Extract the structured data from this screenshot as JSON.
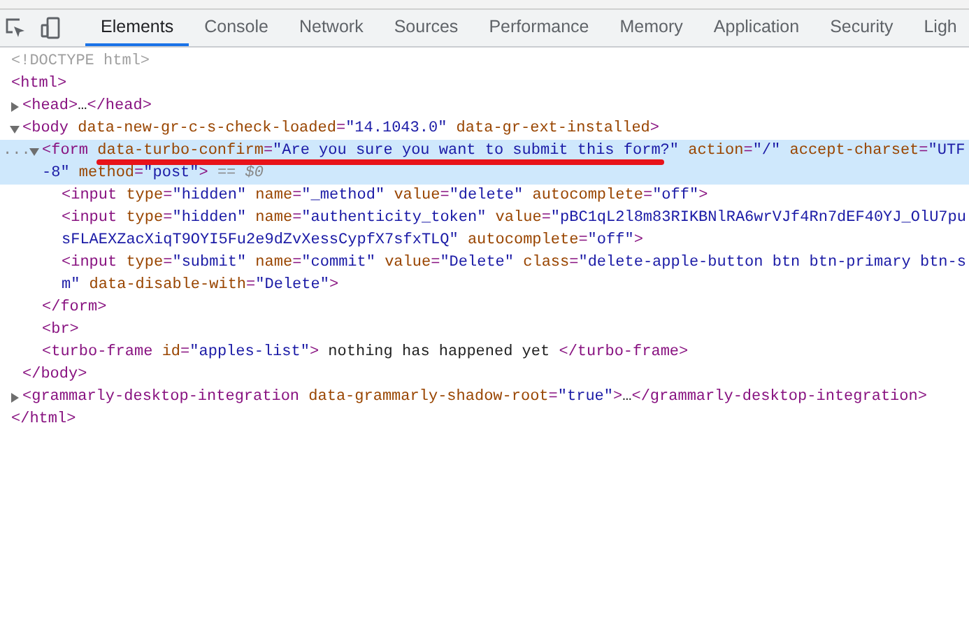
{
  "toolbar": {
    "tabs": [
      {
        "label": "Elements",
        "selected": true
      },
      {
        "label": "Console",
        "selected": false
      },
      {
        "label": "Network",
        "selected": false
      },
      {
        "label": "Sources",
        "selected": false
      },
      {
        "label": "Performance",
        "selected": false
      },
      {
        "label": "Memory",
        "selected": false
      },
      {
        "label": "Application",
        "selected": false
      },
      {
        "label": "Security",
        "selected": false
      },
      {
        "label": "Ligh",
        "selected": false
      }
    ]
  },
  "dom_tree": [
    {
      "selected": false,
      "open": [
        [
          {
            "kind": "doctype",
            "text": "<!DOCTYPE html>"
          }
        ]
      ]
    },
    {
      "selected": false,
      "open": [
        [
          {
            "kind": "tag",
            "text": "<html>"
          }
        ]
      ],
      "close": [
        {
          "kind": "tag",
          "text": "</html>"
        }
      ],
      "children": [
        {
          "selected": false,
          "expanded": false,
          "open": [
            [
              {
                "kind": "tag",
                "text": "<head>"
              },
              {
                "kind": "text",
                "text": "…"
              },
              {
                "kind": "tag",
                "text": "</head>"
              }
            ]
          ]
        },
        {
          "selected": false,
          "expanded": true,
          "open": [
            [
              {
                "kind": "tag",
                "text": "<body"
              },
              {
                "kind": "attr",
                "text": " data-new-gr-c-s-check-loaded"
              },
              {
                "kind": "punct",
                "text": "="
              },
              {
                "kind": "value",
                "text": "\"14.1043.0\""
              },
              {
                "kind": "attr",
                "text": " data-gr-ext-installed"
              },
              {
                "kind": "tag",
                "text": ">"
              }
            ]
          ],
          "close": [
            {
              "kind": "tag",
              "text": "</body>"
            }
          ],
          "children": [
            {
              "selected": true,
              "expanded": true,
              "gutter": "...",
              "open": [
                [
                  {
                    "kind": "tag",
                    "text": "<form"
                  },
                  {
                    "kind": "attr",
                    "text": " data-turbo-confirm"
                  },
                  {
                    "kind": "punct",
                    "text": "="
                  },
                  {
                    "kind": "value",
                    "text": "\"Are you sure you want to submit this form?\""
                  },
                  {
                    "kind": "attr",
                    "text": " action"
                  },
                  {
                    "kind": "punct",
                    "text": "="
                  },
                  {
                    "kind": "value",
                    "text": "\"/\""
                  },
                  {
                    "kind": "attr",
                    "text": " accept-charset"
                  },
                  {
                    "kind": "punct",
                    "text": "="
                  },
                  {
                    "kind": "value",
                    "text": "\"UTF"
                  }
                ],
                [
                  {
                    "kind": "value",
                    "text": "-8\""
                  },
                  {
                    "kind": "attr",
                    "text": " method"
                  },
                  {
                    "kind": "punct",
                    "text": "="
                  },
                  {
                    "kind": "value",
                    "text": "\"post\""
                  },
                  {
                    "kind": "tag",
                    "text": ">"
                  },
                  {
                    "kind": "hint",
                    "text": " == $0"
                  }
                ]
              ],
              "close": [
                {
                  "kind": "tag",
                  "text": "</form>"
                }
              ],
              "children": [
                {
                  "selected": false,
                  "open": [
                    [
                      {
                        "kind": "tag",
                        "text": "<input"
                      },
                      {
                        "kind": "attr",
                        "text": " type"
                      },
                      {
                        "kind": "punct",
                        "text": "="
                      },
                      {
                        "kind": "value",
                        "text": "\"hidden\""
                      },
                      {
                        "kind": "attr",
                        "text": " name"
                      },
                      {
                        "kind": "punct",
                        "text": "="
                      },
                      {
                        "kind": "value",
                        "text": "\"_method\""
                      },
                      {
                        "kind": "attr",
                        "text": " value"
                      },
                      {
                        "kind": "punct",
                        "text": "="
                      },
                      {
                        "kind": "value",
                        "text": "\"delete\""
                      },
                      {
                        "kind": "attr",
                        "text": " autocomplete"
                      },
                      {
                        "kind": "punct",
                        "text": "="
                      },
                      {
                        "kind": "value",
                        "text": "\"off\""
                      },
                      {
                        "kind": "tag",
                        "text": ">"
                      }
                    ]
                  ]
                },
                {
                  "selected": false,
                  "open": [
                    [
                      {
                        "kind": "tag",
                        "text": "<input"
                      },
                      {
                        "kind": "attr",
                        "text": " type"
                      },
                      {
                        "kind": "punct",
                        "text": "="
                      },
                      {
                        "kind": "value",
                        "text": "\"hidden\""
                      },
                      {
                        "kind": "attr",
                        "text": " name"
                      },
                      {
                        "kind": "punct",
                        "text": "="
                      },
                      {
                        "kind": "value",
                        "text": "\"authenticity_token\""
                      },
                      {
                        "kind": "attr",
                        "text": " value"
                      },
                      {
                        "kind": "punct",
                        "text": "="
                      },
                      {
                        "kind": "value",
                        "text": "\"pBC1qL2l8m83RIKBNlRA6wrVJf4Rn7dEF40YJ_OlU7pu"
                      }
                    ],
                    [
                      {
                        "kind": "value",
                        "text": "sFLAEXZacXiqT9OYI5Fu2e9dZvXessCypfX7sfxTLQ\""
                      },
                      {
                        "kind": "attr",
                        "text": " autocomplete"
                      },
                      {
                        "kind": "punct",
                        "text": "="
                      },
                      {
                        "kind": "value",
                        "text": "\"off\""
                      },
                      {
                        "kind": "tag",
                        "text": ">"
                      }
                    ]
                  ]
                },
                {
                  "selected": false,
                  "open": [
                    [
                      {
                        "kind": "tag",
                        "text": "<input"
                      },
                      {
                        "kind": "attr",
                        "text": " type"
                      },
                      {
                        "kind": "punct",
                        "text": "="
                      },
                      {
                        "kind": "value",
                        "text": "\"submit\""
                      },
                      {
                        "kind": "attr",
                        "text": " name"
                      },
                      {
                        "kind": "punct",
                        "text": "="
                      },
                      {
                        "kind": "value",
                        "text": "\"commit\""
                      },
                      {
                        "kind": "attr",
                        "text": " value"
                      },
                      {
                        "kind": "punct",
                        "text": "="
                      },
                      {
                        "kind": "value",
                        "text": "\"Delete\""
                      },
                      {
                        "kind": "attr",
                        "text": " class"
                      },
                      {
                        "kind": "punct",
                        "text": "="
                      },
                      {
                        "kind": "value",
                        "text": "\"delete-apple-button btn btn-primary btn-s"
                      }
                    ],
                    [
                      {
                        "kind": "value",
                        "text": "m\""
                      },
                      {
                        "kind": "attr",
                        "text": " data-disable-with"
                      },
                      {
                        "kind": "punct",
                        "text": "="
                      },
                      {
                        "kind": "value",
                        "text": "\"Delete\""
                      },
                      {
                        "kind": "tag",
                        "text": ">"
                      }
                    ]
                  ]
                }
              ]
            },
            {
              "selected": false,
              "open": [
                [
                  {
                    "kind": "tag",
                    "text": "<br>"
                  }
                ]
              ]
            },
            {
              "selected": false,
              "open": [
                [
                  {
                    "kind": "tag",
                    "text": "<turbo-frame"
                  },
                  {
                    "kind": "attr",
                    "text": " id"
                  },
                  {
                    "kind": "punct",
                    "text": "="
                  },
                  {
                    "kind": "value",
                    "text": "\"apples-list\""
                  },
                  {
                    "kind": "tag",
                    "text": ">"
                  },
                  {
                    "kind": "text",
                    "text": " nothing has happened yet "
                  },
                  {
                    "kind": "tag",
                    "text": "</turbo-frame>"
                  }
                ]
              ]
            }
          ]
        },
        {
          "selected": false,
          "expanded": false,
          "open": [
            [
              {
                "kind": "tag",
                "text": "<grammarly-desktop-integration"
              },
              {
                "kind": "attr",
                "text": " data-grammarly-shadow-root"
              },
              {
                "kind": "punct",
                "text": "="
              },
              {
                "kind": "value",
                "text": "\"true\""
              },
              {
                "kind": "tag",
                "text": ">"
              },
              {
                "kind": "text",
                "text": "…"
              },
              {
                "kind": "tag",
                "text": "</grammarly-desktop-integration>"
              }
            ]
          ]
        }
      ]
    }
  ]
}
